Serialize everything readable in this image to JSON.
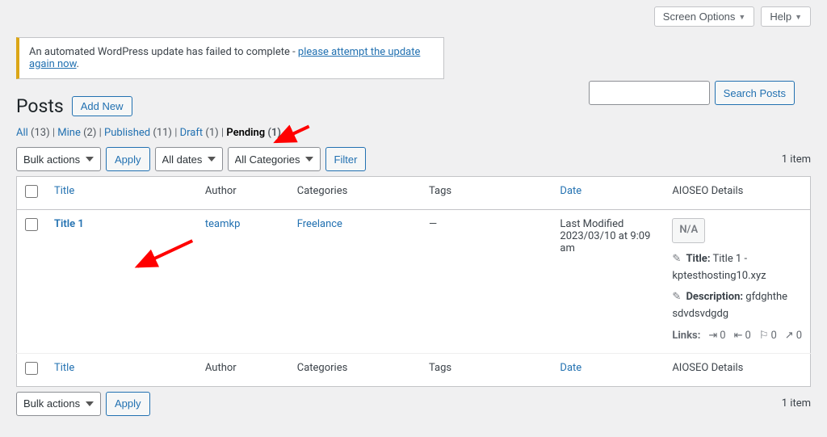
{
  "top": {
    "screen_options": "Screen Options",
    "help": "Help"
  },
  "notice": {
    "text": "An automated WordPress update has failed to complete - ",
    "link": "please attempt the update again now"
  },
  "heading": {
    "title": "Posts",
    "add_new": "Add New"
  },
  "filters": {
    "all": {
      "label": "All",
      "count": "(13)"
    },
    "mine": {
      "label": "Mine",
      "count": "(2)"
    },
    "published": {
      "label": "Published",
      "count": "(11)"
    },
    "draft": {
      "label": "Draft",
      "count": "(1)"
    },
    "pending": {
      "label": "Pending",
      "count": "(1)"
    }
  },
  "search": {
    "button": "Search Posts"
  },
  "nav": {
    "bulk_actions": "Bulk actions",
    "apply": "Apply",
    "all_dates": "All dates",
    "all_categories": "All Categories",
    "filter": "Filter",
    "item_count": "1 item"
  },
  "columns": {
    "title": "Title",
    "author": "Author",
    "categories": "Categories",
    "tags": "Tags",
    "date": "Date",
    "aioseo": "AIOSEO Details"
  },
  "row": {
    "title": "Title 1",
    "author": "teamkp",
    "category": "Freelance",
    "tags": "—",
    "date_label": "Last Modified",
    "date_value": "2023/03/10 at 9:09 am",
    "aioseo": {
      "badge": "N/A",
      "title_label": "Title:",
      "title_value": "Title 1 - kptesthosting10.xyz",
      "desc_label": "Description:",
      "desc_value": "gfdghthe sdvdsvdgdg",
      "links_label": "Links:",
      "stats": [
        "0",
        "0",
        "0",
        "0"
      ]
    }
  }
}
